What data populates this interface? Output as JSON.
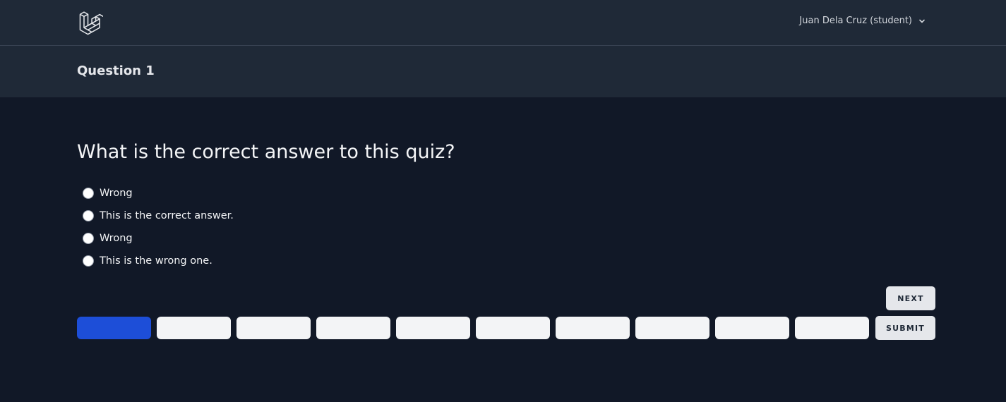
{
  "nav": {
    "user_label": "Juan Dela Cruz (student)"
  },
  "header": {
    "title": "Question 1"
  },
  "quiz": {
    "question": "What is the correct answer to this quiz?",
    "options": [
      {
        "label": "Wrong"
      },
      {
        "label": "This is the correct answer."
      },
      {
        "label": "Wrong"
      },
      {
        "label": "This is the wrong one."
      }
    ]
  },
  "buttons": {
    "next": "NEXT",
    "submit": "SUBMIT"
  },
  "pagination": {
    "total": 10,
    "current": 1
  },
  "colors": {
    "background": "#111827",
    "header": "#1f2937",
    "active_page": "#1d4ed8",
    "page_button": "#f3f4f6"
  }
}
